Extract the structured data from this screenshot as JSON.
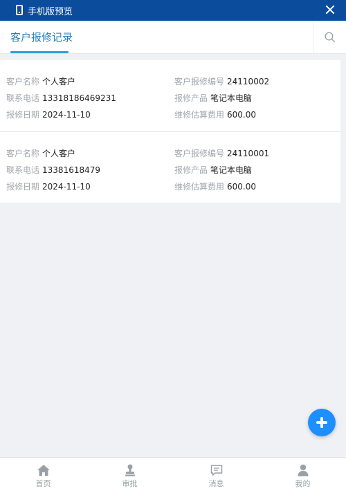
{
  "window": {
    "title": "手机版预览"
  },
  "tabs": {
    "active_label": "客户报修记录"
  },
  "records": [
    {
      "customer_name_label": "客户名称",
      "customer_name": "个人客户",
      "repair_no_label": "客户报修编号",
      "repair_no": "24110002",
      "phone_label": "联系电话",
      "phone": "13318186469231",
      "product_label": "报修产品",
      "product": "笔记本电脑",
      "date_label": "报修日期",
      "date": "2024-11-10",
      "fee_label": "维修估算费用",
      "fee": "600.00"
    },
    {
      "customer_name_label": "客户名称",
      "customer_name": "个人客户",
      "repair_no_label": "客户报修编号",
      "repair_no": "24110001",
      "phone_label": "联系电话",
      "phone": "13381618479",
      "product_label": "报修产品",
      "product": "笔记本电脑",
      "date_label": "报修日期",
      "date": "2024-11-10",
      "fee_label": "维修估算费用",
      "fee": "600.00"
    }
  ],
  "bottom_nav": [
    {
      "label": "首页",
      "icon": "home-icon"
    },
    {
      "label": "审批",
      "icon": "stamp-icon"
    },
    {
      "label": "消息",
      "icon": "message-icon"
    },
    {
      "label": "我的",
      "icon": "user-icon"
    }
  ],
  "colors": {
    "titlebar": "#0b4c9c",
    "accent": "#2f9ed3",
    "fab": "#1e8fff"
  }
}
